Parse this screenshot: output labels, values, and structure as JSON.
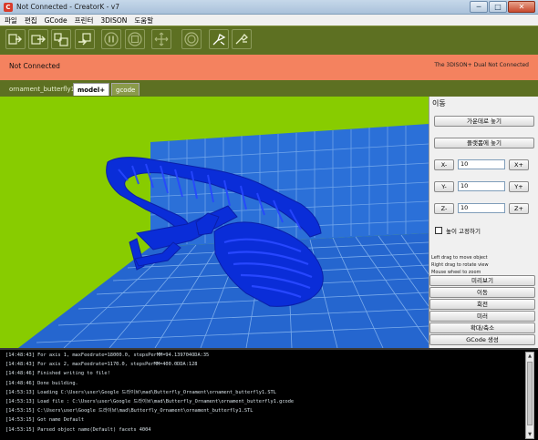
{
  "window": {
    "title": "Not Connected - CreatorK - v7",
    "minimize": "─",
    "maximize": "□",
    "close": "✕"
  },
  "menu": [
    "파일",
    "편집",
    "GCode",
    "프린터",
    "3DISON",
    "도움말"
  ],
  "toolbar": {
    "buttons": [
      {
        "name": "load-model-button",
        "icon": "load-icon"
      },
      {
        "name": "save-model-button",
        "icon": "save-icon"
      },
      {
        "name": "generate-gcode-button",
        "icon": "slice-icon"
      },
      {
        "name": "print-gcode-button",
        "icon": "print-icon"
      },
      {
        "name": "pause-button",
        "icon": "pause-icon"
      },
      {
        "name": "stop-button",
        "icon": "stop-icon"
      },
      {
        "name": "move-button",
        "icon": "move-icon"
      },
      {
        "name": "connect-button",
        "icon": "connect-icon"
      },
      {
        "name": "manual-control-button",
        "icon": "manual-control-icon"
      },
      {
        "name": "tools-button",
        "icon": "tools-icon"
      }
    ]
  },
  "status": {
    "left": "Not Connected",
    "right": "The 3DISON+ Dual Not Connected",
    "color": "#f4825f"
  },
  "tabs": {
    "file": "ornament_butterfly1",
    "model": "model+",
    "gcode": "gcode"
  },
  "panel": {
    "title": "이동",
    "center": "가운데로 놓기",
    "platform": "플랫폼에 놓기",
    "x": {
      "minus": "X-",
      "value": "10",
      "plus": "X+"
    },
    "y": {
      "minus": "Y-",
      "value": "10",
      "plus": "Y+"
    },
    "z": {
      "minus": "Z-",
      "value": "10",
      "plus": "Z+"
    },
    "lock_height": "높이 고정하기",
    "hints": [
      "Left drag to move object",
      "Right drag to rotate view",
      "Mouse wheel to zoom"
    ],
    "buttons": [
      "미리보기",
      "이동",
      "회전",
      "미러",
      "확대/축소",
      "GCode 생성"
    ]
  },
  "console": [
    "[14:48:43] For axis 1, maxFeedrate=18000.0, stepsPerMM=94.139704ODA:35",
    "[14:48:43] For axis 2, maxFeedrate=1170.0, stepsPerMM=400.0DDA:128",
    "[14:48:46] Finished writing to file!",
    "[14:48:46] Done building.",
    "[14:53:13] Loading C:\\Users\\user\\Google 드라이브\\mad\\Butterfly_Ornament\\ornament_butterfly1.STL",
    "[14:53:13] Load file : C:\\Users\\user\\Google 드라이브\\mad\\Butterfly_Ornament\\ornament_butterfly1.gcode",
    "[14:53:15] C:\\Users\\user\\Google 드라이브\\mad\\Butterfly_Ornament\\ornament_butterfly1.STL",
    "[14:53:15] Got name Default",
    "[14:53:15] Parsed object name(Default) facets 4004"
  ],
  "colors": {
    "toolbar": "#5d7022",
    "viewport": "#88cc00",
    "bed": "#2a6fd6",
    "model": "#0a2dd8"
  }
}
